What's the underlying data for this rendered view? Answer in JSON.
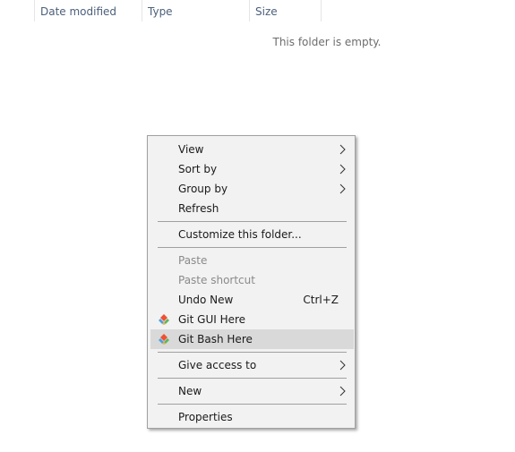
{
  "columns": {
    "date_modified": "Date modified",
    "type": "Type",
    "size": "Size"
  },
  "empty_message": "This folder is empty.",
  "context_menu": {
    "view": "View",
    "sort_by": "Sort by",
    "group_by": "Group by",
    "refresh": "Refresh",
    "customize": "Customize this folder...",
    "paste": "Paste",
    "paste_shortcut": "Paste shortcut",
    "undo_new": "Undo New",
    "undo_new_shortcut": "Ctrl+Z",
    "git_gui": "Git GUI Here",
    "git_bash": "Git Bash Here",
    "give_access": "Give access to",
    "new": "New",
    "properties": "Properties"
  },
  "icons": {
    "submenu": "chevron-right-icon",
    "git": "git-icon"
  }
}
